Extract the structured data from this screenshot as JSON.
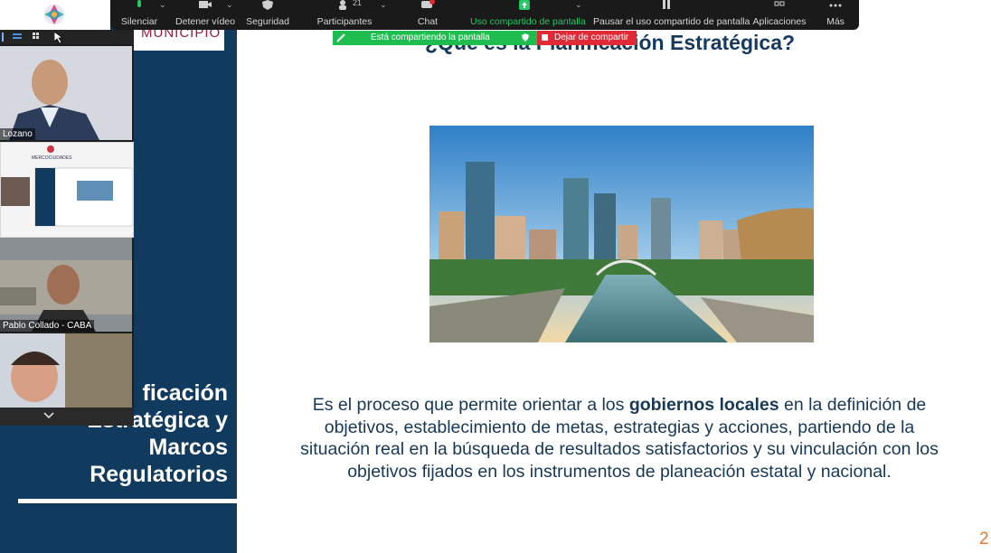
{
  "toolbar": {
    "mute": "Silenciar",
    "video": "Detener vídeo",
    "security": "Seguridad",
    "participants": "Participantes",
    "participants_count": "21",
    "chat": "Chat",
    "share": "Uso compartido de pantalla",
    "pause_share": "Pausar el uso compartido de pantalla",
    "apps": "Aplicaciones",
    "more": "Más"
  },
  "share_banner": {
    "sharing_text": "Está compartiendo la pantalla",
    "stop_text": "Dejar de compartir"
  },
  "gallery": {
    "participants": [
      {
        "name": "Lozano"
      },
      {
        "name": ""
      },
      {
        "name": "Pablo Collado - CABA"
      },
      {
        "name": ""
      }
    ],
    "thumb_brand": "MERCOCIUDADES"
  },
  "slide": {
    "logo_text": "MUNICIPIO",
    "heading": "¿Qué es la Planificación Estratégica?",
    "side_title": [
      "ficación",
      "Estratégica y",
      "Marcos",
      "Regulatorios"
    ],
    "body_before": "Es el proceso que permite orientar a los ",
    "body_bold": "gobiernos locales",
    "body_after": " en la definición de objetivos, establecimiento de metas, estrategias y acciones, partiendo de la situación real en la búsqueda de resultados satisfactorios y su vinculación con los objetivos fijados en los instrumentos de planeación estatal y nacional.",
    "page_number": "2"
  },
  "colors": {
    "navy": "#113a5f",
    "toolbar": "#1a1a1a",
    "share_green": "#1fbd4f",
    "stop_red": "#e02b37",
    "page_number": "#e27a2b"
  }
}
